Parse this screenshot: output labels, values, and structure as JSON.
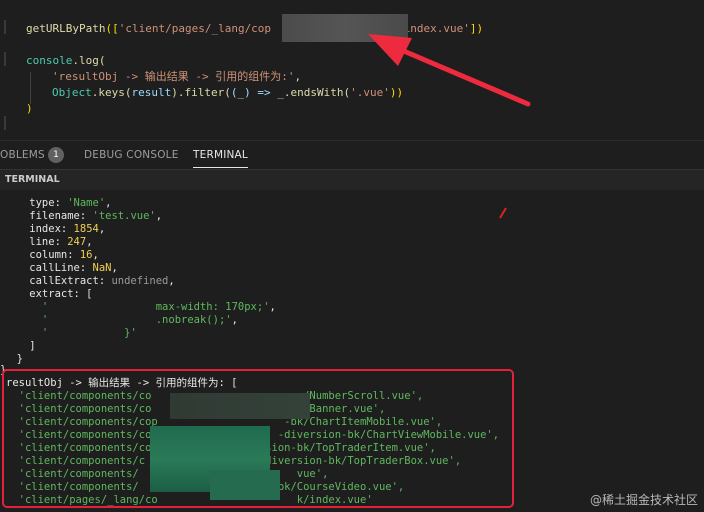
{
  "editor": {
    "line1_fn": "getURLByPath",
    "line1_args_open": "([",
    "line1_str_a": "'client/pages/_lang/cop",
    "line1_str_b": "/index.vue'",
    "line1_close": "])",
    "line2_obj": "console",
    "line2_fn": ".log(",
    "line3_str": "'resultObj -> 输出结果 -> 引用的组件为:'",
    "line3_comma": ",",
    "line4_obj": "Object",
    "line4_fn1": ".keys(",
    "line4_var1": "result",
    "line4_fn2": ").filter(",
    "line4_arrow": "(_) => _",
    "line4_fn3": ".endsWith(",
    "line4_str": "'.vue'",
    "line4_close": "))",
    "line5": ")"
  },
  "panel_tabs": {
    "problems": "OBLEMS",
    "problems_count": "1",
    "debug_console": "DEBUG CONSOLE",
    "terminal": "TERMINAL"
  },
  "terminal": {
    "header": "TERMINAL",
    "lines": {
      "type_key": "    type: ",
      "type_val": "'Name'",
      "type_end": ",",
      "filename_key": "    filename: ",
      "filename_val": "'test.vue'",
      "filename_end": ",",
      "index_key": "    index: ",
      "index_val": "1854",
      "index_end": ",",
      "line_key": "    line: ",
      "line_val": "247",
      "line_end": ",",
      "column_key": "    column: ",
      "column_val": "16",
      "column_end": ",",
      "callline_key": "    callLine: ",
      "callline_val": "NaN",
      "callline_end": ",",
      "callextract_key": "    callExtract: ",
      "callextract_val": "undefined",
      "callextract_end": ",",
      "extract_key": "    extract: [",
      "ex1_q": "      '",
      "ex1_val": "                 max-width: 170px;'",
      "ex1_end": ",",
      "ex2_q": "      '",
      "ex2_val": "                 .nobreak();'",
      "ex2_end": ",",
      "ex3_q": "      '",
      "ex3_val": "            }'",
      "close_bracket": "    ]",
      "close_brace_1": "  }",
      "close_brace_2": "}"
    },
    "result_header": "resultObj -> 输出结果 -> 引用的组件为: [",
    "results": [
      "  'client/components/co                        /NumberScroll.vue',",
      "  'client/components/co                        /Banner.vue',",
      "  'client/components/cop                    -bk/ChartItemMobile.vue',",
      "  'client/components/copy                  -diversion-bk/ChartViewMobile.vue',",
      "  'client/components/copy_____g_mix/diversion-bk/TopTraderItem.vue',",
      "  'client/components/c                   diversion-bk/TopTraderBox.vue',",
      "  'client/components/                         vue',",
      "  'client/components/                      bk/CourseVideo.vue',",
      "  'client/pages/_lang/co                      k/index.vue'"
    ]
  },
  "watermark": "@稀土掘金技术社区"
}
